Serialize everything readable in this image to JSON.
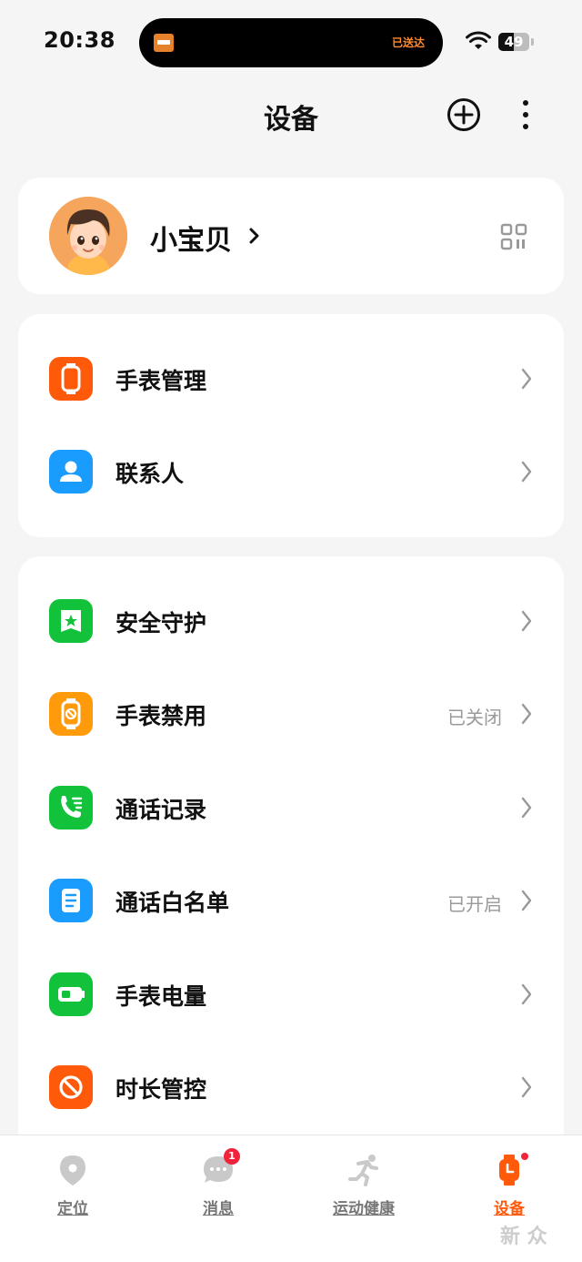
{
  "status_bar": {
    "time": "20:38",
    "island_text": "已送达",
    "battery": "49",
    "battery_level": 0.49
  },
  "header": {
    "title": "设备"
  },
  "profile": {
    "name": "小宝贝"
  },
  "group1": [
    {
      "label": "手表管理",
      "status": "",
      "color": "#ff5a0a",
      "icon": "watch-icon"
    },
    {
      "label": "联系人",
      "status": "",
      "color": "#1a9cff",
      "icon": "person-icon"
    }
  ],
  "group2": [
    {
      "label": "安全守护",
      "status": "",
      "color": "#12c23a",
      "icon": "shield-icon"
    },
    {
      "label": "手表禁用",
      "status": "已关闭",
      "color": "#ff9a0a",
      "icon": "watch-ban-icon"
    },
    {
      "label": "通话记录",
      "status": "",
      "color": "#12c23a",
      "icon": "phone-icon"
    },
    {
      "label": "通话白名单",
      "status": "已开启",
      "color": "#1a9cff",
      "icon": "document-icon"
    },
    {
      "label": "手表电量",
      "status": "",
      "color": "#12c23a",
      "icon": "battery-icon"
    },
    {
      "label": "时长管控",
      "status": "",
      "color": "#ff5a0a",
      "icon": "ban-icon"
    }
  ],
  "nav": [
    {
      "label": "定位",
      "icon": "location-icon"
    },
    {
      "label": "消息",
      "icon": "chat-icon",
      "badge": "1"
    },
    {
      "label": "运动健康",
      "icon": "running-icon"
    },
    {
      "label": "设备",
      "icon": "device-watch-icon",
      "active": true
    }
  ],
  "watermark": "新 众"
}
